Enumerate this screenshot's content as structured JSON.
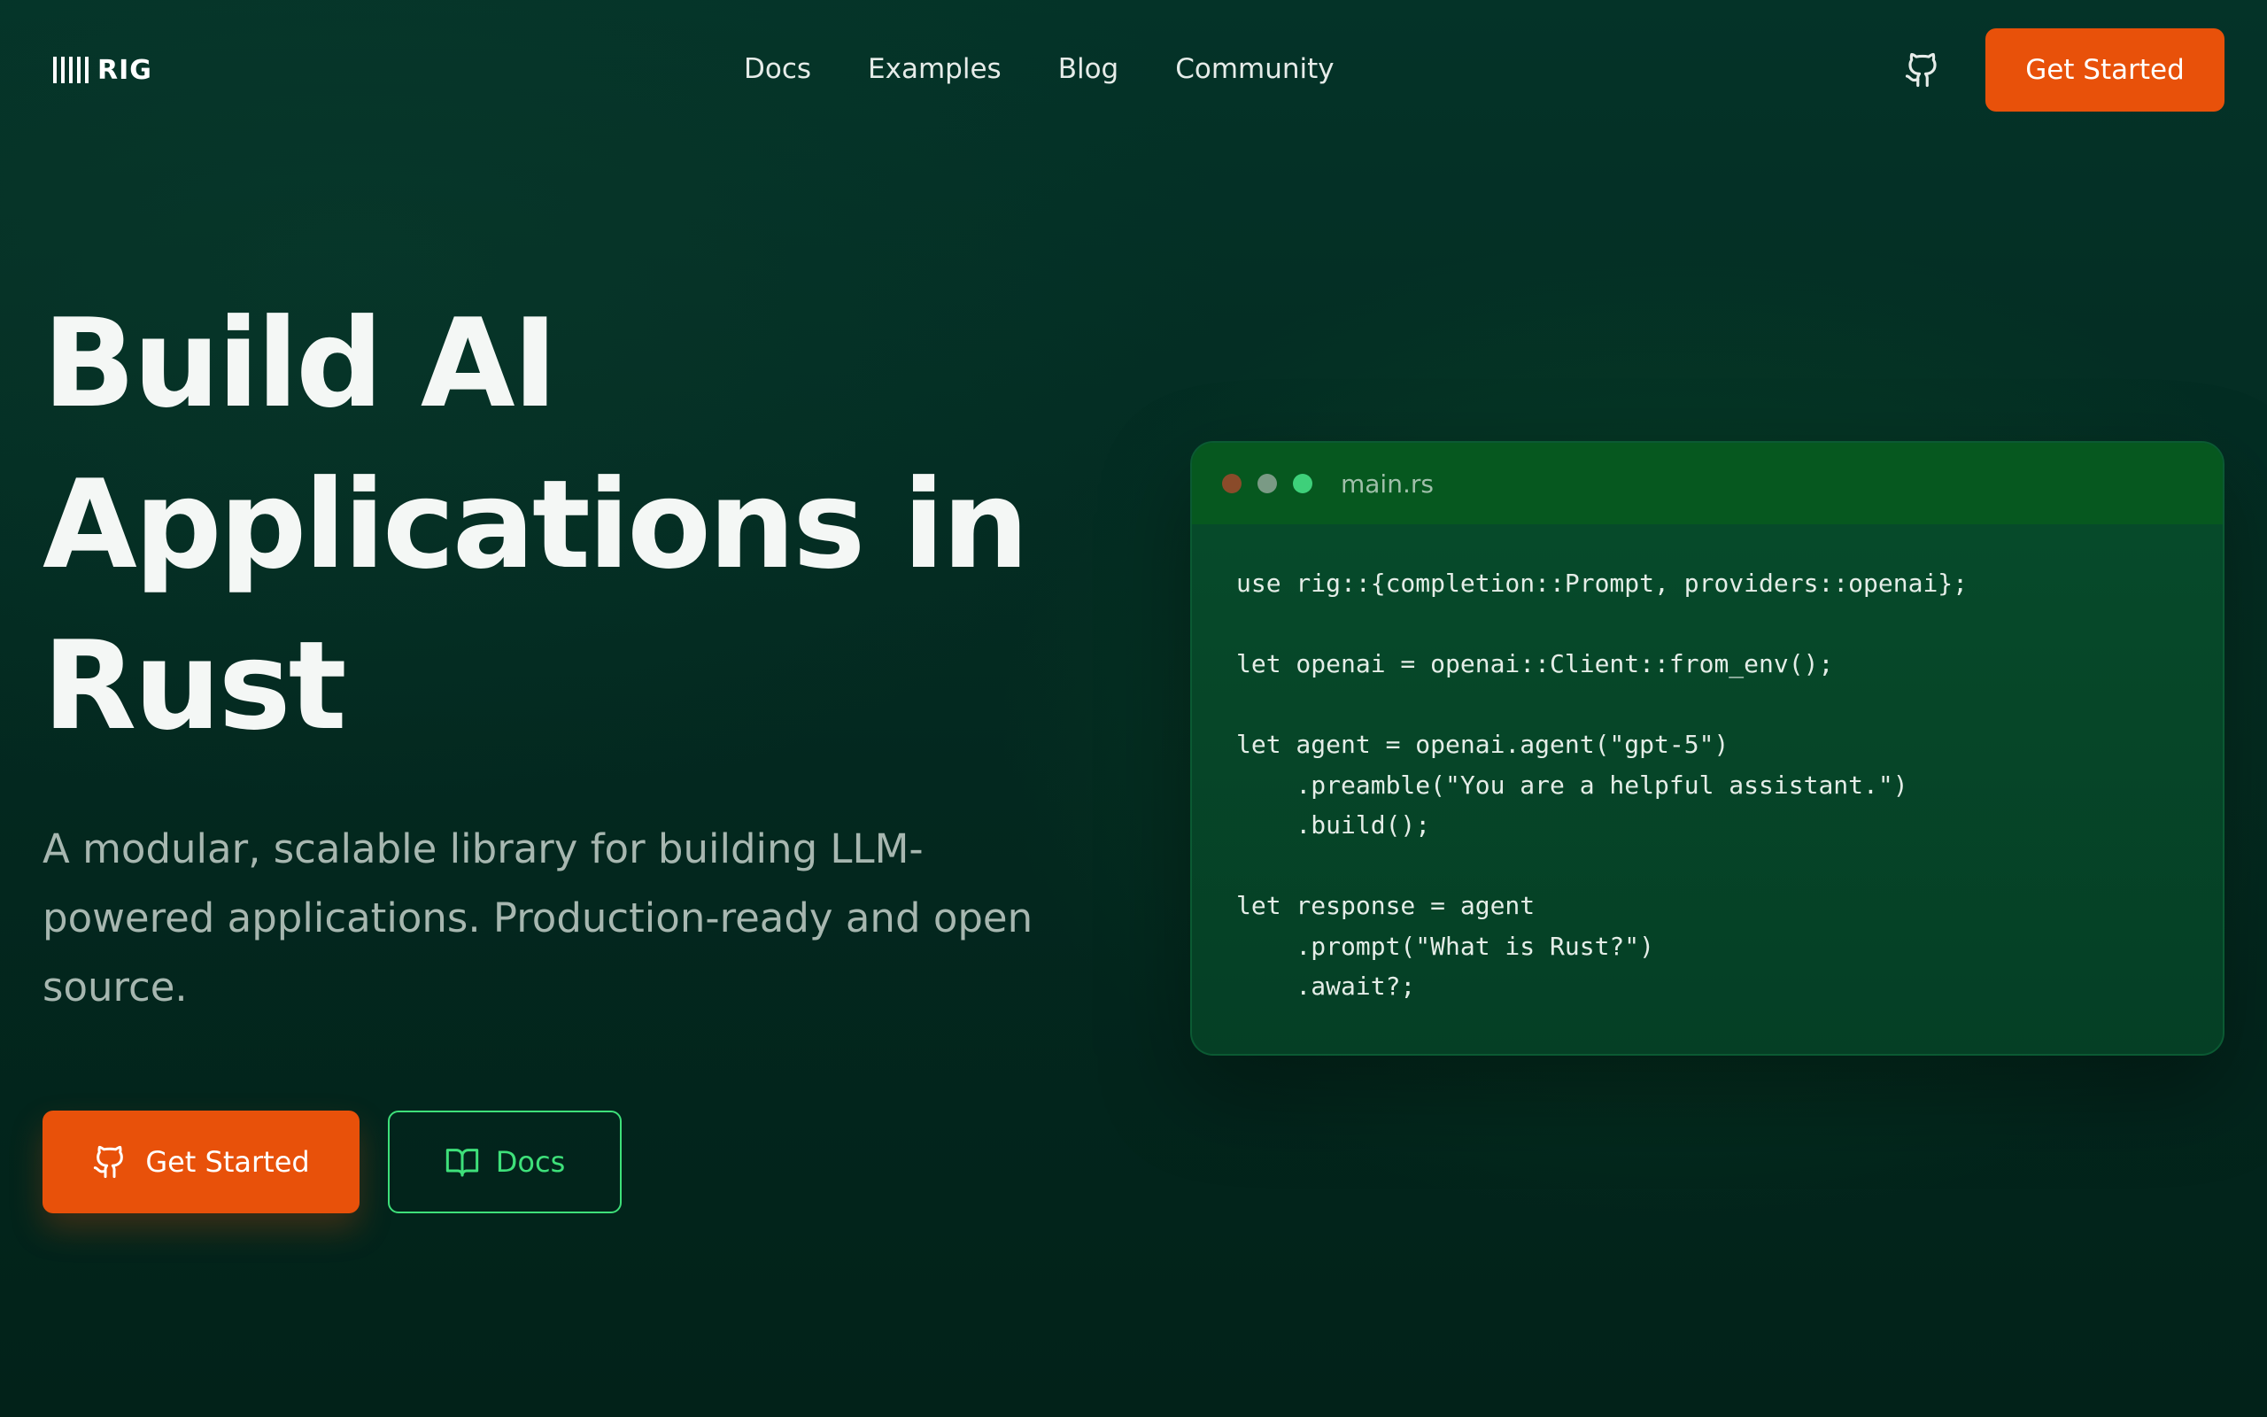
{
  "nav": {
    "logo_text": "RIG",
    "links": [
      "Docs",
      "Examples",
      "Blog",
      "Community"
    ],
    "github_icon": "github-icon",
    "cta_label": "Get Started"
  },
  "hero": {
    "title": "Build AI Applications in Rust",
    "subtitle": "A modular, scalable library for building LLM-powered applications. Production-ready and open source.",
    "primary_button": {
      "label": "Get Started",
      "icon": "github-icon"
    },
    "secondary_button": {
      "label": "Docs",
      "icon": "book-icon"
    }
  },
  "code_window": {
    "filename": "main.rs",
    "lines": [
      "use rig::{completion::Prompt, providers::openai};",
      "",
      "let openai = openai::Client::from_env();",
      "",
      "let agent = openai.agent(\"gpt-5\")",
      "    .preamble(\"You are a helpful assistant.\")",
      "    .build();",
      "",
      "let response = agent",
      "    .prompt(\"What is Rust?\")",
      "    .await?;"
    ]
  },
  "colors": {
    "background": "#032a20",
    "accent_orange": "#e8510a",
    "accent_green": "#3ee07a",
    "code_bg": "#06482a"
  }
}
